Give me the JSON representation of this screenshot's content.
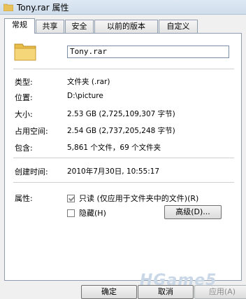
{
  "window": {
    "title": "Tony.rar 属性"
  },
  "tabs": [
    {
      "label": "常规"
    },
    {
      "label": "共享"
    },
    {
      "label": "安全"
    },
    {
      "label": "以前的版本"
    },
    {
      "label": "自定义"
    }
  ],
  "general": {
    "name_value": "Tony.rar",
    "rows": [
      {
        "label": "类型:",
        "value": "文件夹 (.rar)"
      },
      {
        "label": "位置:",
        "value": "D:\\picture"
      },
      {
        "label": "大小:",
        "value": "2.53 GB (2,725,109,307 字节)"
      },
      {
        "label": "占用空间:",
        "value": "2.54 GB (2,737,205,248 字节)"
      },
      {
        "label": "包含:",
        "value": "5,861 个文件，69 个文件夹"
      },
      {
        "label": "创建时间:",
        "value": "2010年7月30日, 10:55:17"
      }
    ],
    "attributes_label": "属性:",
    "readonly": {
      "label": "只读 (仅应用于文件夹中的文件)(R)",
      "checked": true
    },
    "hidden": {
      "label": "隐藏(H)",
      "checked": false
    },
    "advanced_button": "高级(D)..."
  },
  "buttons": {
    "ok": "确定",
    "cancel": "取消",
    "apply": "应用(A)"
  },
  "watermark": "HGame5"
}
